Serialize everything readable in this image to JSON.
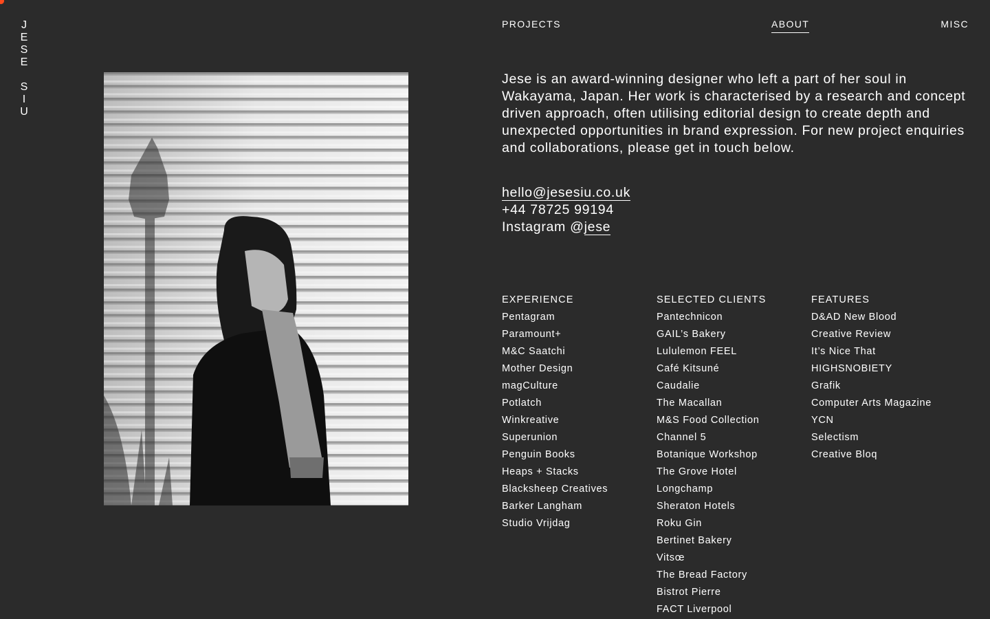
{
  "logo": {
    "letters_top": [
      "J",
      "E",
      "S",
      "E"
    ],
    "letters_bottom": [
      "S",
      "I",
      "U"
    ]
  },
  "nav": {
    "projects": "PROJECTS",
    "about": "ABOUT",
    "misc": "MISC",
    "active": "about"
  },
  "bio": "Jese is an award-winning designer who left a part of her soul in Wakayama, Japan. Her work is characterised by a research and concept driven approach, often utilising editorial design to create depth and unexpected opportunities in brand expression. For new project enquiries and collaborations, please get in touch below.",
  "contact": {
    "email": "hello@jesesiu.co.uk",
    "phone": "+44 78725 99194",
    "instagram_prefix": "Instagram @",
    "instagram_handle": "jese"
  },
  "experience": {
    "heading": "EXPERIENCE",
    "items": [
      "Pentagram",
      "Paramount+",
      "M&C Saatchi",
      "Mother Design",
      "magCulture",
      "Potlatch",
      "Winkreative",
      "Superunion",
      "Penguin Books",
      "Heaps + Stacks",
      "Blacksheep Creatives",
      "Barker Langham",
      "Studio Vrijdag"
    ]
  },
  "clients": {
    "heading": "SELECTED CLIENTS",
    "items": [
      "Pantechnicon",
      "GAIL’s Bakery",
      "Lululemon FEEL",
      "Café Kitsuné",
      "Caudalie",
      "The Macallan",
      "M&S Food Collection",
      "Channel 5",
      "Botanique Workshop",
      "The Grove Hotel",
      "Longchamp",
      "Sheraton Hotels",
      "Roku Gin",
      "Bertinet Bakery",
      "Vitsœ",
      "The Bread Factory",
      "Bistrot Pierre",
      "FACT Liverpool"
    ]
  },
  "features": {
    "heading": "FEATURES",
    "items": [
      "D&AD New Blood",
      "Creative Review",
      "It’s Nice That",
      "HIGHSNOBIETY",
      "Grafik",
      "Computer Arts Magazine",
      "YCN",
      "Selectism",
      "Creative Bloq"
    ]
  },
  "colors": {
    "background": "#2b2b2b",
    "text": "#ffffff",
    "accent": "#ff4a1c"
  }
}
